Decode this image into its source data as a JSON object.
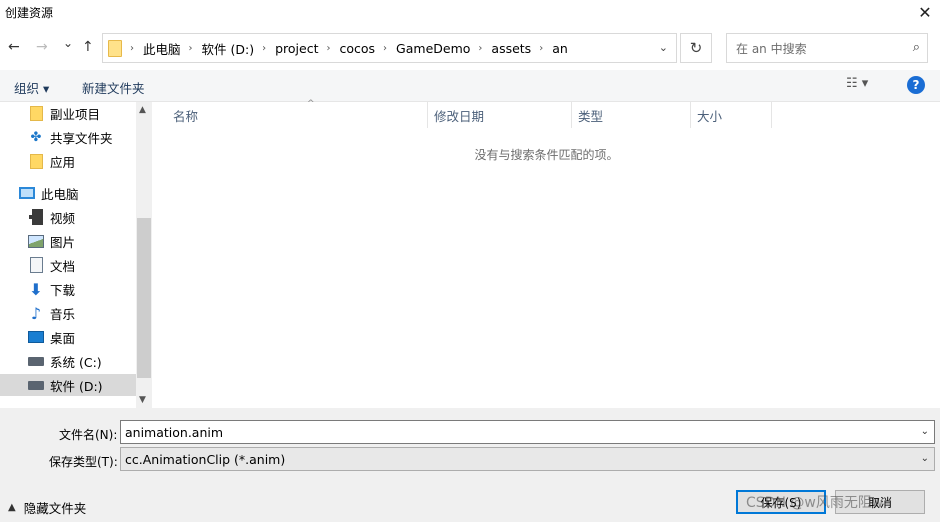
{
  "window": {
    "title": "创建资源",
    "close_glyph": "✕"
  },
  "nav": {
    "back_glyph": "←",
    "forward_glyph": "→",
    "recent_glyph": "⌄",
    "up_glyph": "↑",
    "breadcrumbs": [
      "此电脑",
      "软件 (D:)",
      "project",
      "cocos",
      "GameDemo",
      "assets",
      "an"
    ],
    "separator_glyph": "›",
    "dropdown_glyph": "⌄",
    "refresh_glyph": "↻",
    "search_placeholder": "在 an 中搜索",
    "search_glyph": "⌕"
  },
  "toolbar": {
    "organize_label": "组织 ▾",
    "new_folder_label": "新建文件夹",
    "view_glyph": "☷ ▾",
    "help_glyph": "?"
  },
  "sidebar": {
    "items": [
      {
        "label": "副业项目",
        "icon": "folder-icon"
      },
      {
        "label": "共享文件夹",
        "icon": "share-icon"
      },
      {
        "label": "应用",
        "icon": "folder-icon"
      },
      {
        "label": "此电脑",
        "icon": "computer-icon"
      },
      {
        "label": "视频",
        "icon": "video-icon"
      },
      {
        "label": "图片",
        "icon": "pictures-icon"
      },
      {
        "label": "文档",
        "icon": "documents-icon"
      },
      {
        "label": "下载",
        "icon": "downloads-icon"
      },
      {
        "label": "音乐",
        "icon": "music-icon"
      },
      {
        "label": "桌面",
        "icon": "desktop-icon"
      },
      {
        "label": "系统 (C:)",
        "icon": "drive-icon"
      },
      {
        "label": "软件 (D:)",
        "icon": "drive-icon",
        "selected": true
      }
    ],
    "scroll_up_glyph": "▲",
    "scroll_down_glyph": "▼"
  },
  "files": {
    "columns": [
      "名称",
      "修改日期",
      "类型",
      "大小"
    ],
    "sort_glyph": "^",
    "empty_message": "没有与搜索条件匹配的项。"
  },
  "form": {
    "filename_label": "文件名(N):",
    "filename_value": "animation.anim",
    "filetype_label": "保存类型(T):",
    "filetype_value": "cc.AnimationClip (*.anim)",
    "chevron_glyph": "⌄"
  },
  "footer": {
    "hide_folders_label": "隐藏文件夹",
    "hide_caret_glyph": "▲",
    "save_label": "保存(S)",
    "cancel_label": "取消",
    "watermark": "CSDN @w风雨无阻w"
  },
  "colors": {
    "accent": "#0078d7",
    "help": "#1a6dd4",
    "folder": "#ffd864"
  }
}
